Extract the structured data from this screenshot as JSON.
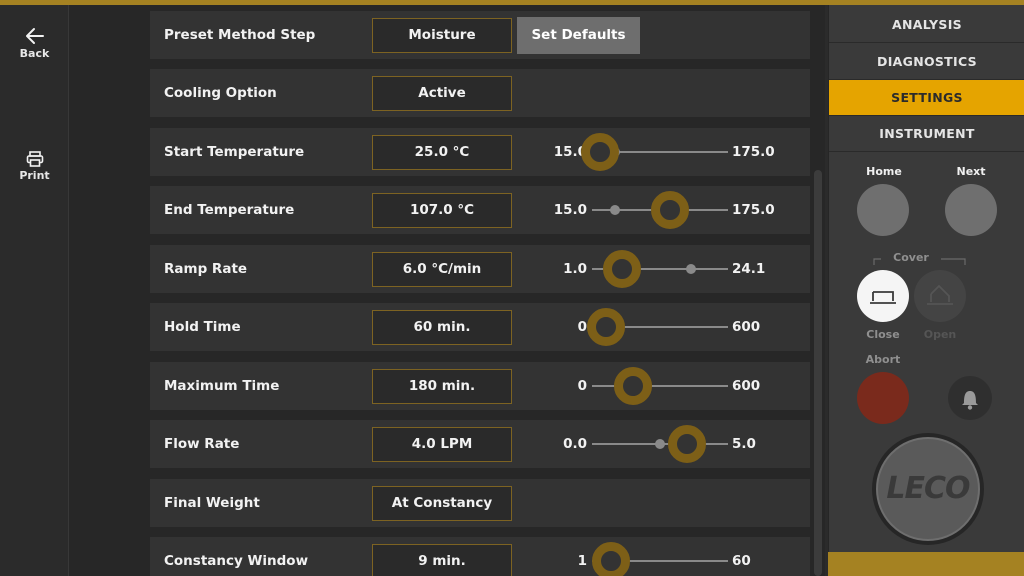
{
  "nav": {
    "back_label": "Back",
    "print_label": "Print"
  },
  "settings": {
    "set_defaults_label": "Set Defaults",
    "rows": [
      {
        "label": "Preset Method Step",
        "value": "Moisture"
      },
      {
        "label": "Cooling Option",
        "value": "Active"
      },
      {
        "label": "Start Temperature",
        "value": "25.0 °C",
        "min": "15.0",
        "max": "175.0",
        "level": 0.06,
        "marker": 0.17
      },
      {
        "label": "End Temperature",
        "value": "107.0 °C",
        "min": "15.0",
        "max": "175.0",
        "level": 0.57,
        "marker": 0.17
      },
      {
        "label": "Ramp Rate",
        "value": "6.0 °C/min",
        "min": "1.0",
        "max": "24.1",
        "level": 0.22,
        "marker": 0.73
      },
      {
        "label": "Hold Time",
        "value": "60 min.",
        "min": "0",
        "max": "600",
        "level": 0.1,
        "marker": 0.13
      },
      {
        "label": "Maximum Time",
        "value": "180 min.",
        "min": "0",
        "max": "600",
        "level": 0.3,
        "marker": 0.33
      },
      {
        "label": "Flow Rate",
        "value": "4.0 LPM",
        "min": "0.0",
        "max": "5.0",
        "level": 0.7,
        "marker": 0.5
      },
      {
        "label": "Final Weight",
        "value": "At Constancy"
      },
      {
        "label": "Constancy Window",
        "value": "9 min.",
        "min": "1",
        "max": "60",
        "level": 0.14,
        "marker": 0.14
      }
    ]
  },
  "tabs": {
    "analysis": "ANALYSIS",
    "diagnostics": "DIAGNOSTICS",
    "settings": "SETTINGS",
    "instrument": "INSTRUMENT"
  },
  "controls": {
    "home_label": "Home",
    "next_label": "Next",
    "cover_label": "Cover",
    "close_label": "Close",
    "open_label": "Open",
    "abort_label": "Abort",
    "logo_text": "LECO"
  },
  "colors": {
    "accent": "#e5a400",
    "knob_ring": "#7d5f17",
    "abort_red": "#7a2a1c"
  }
}
